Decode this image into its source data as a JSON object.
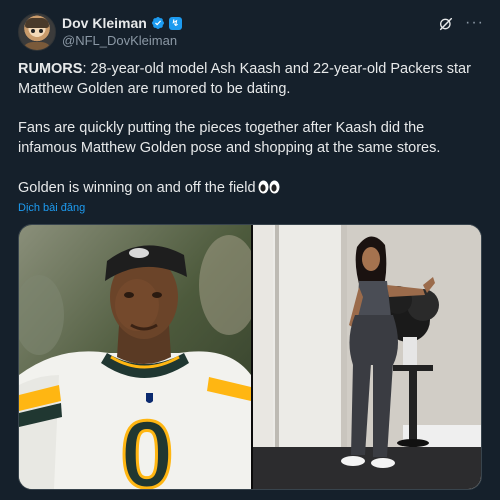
{
  "author": {
    "name": "Dov Kleiman",
    "handle": "@NFL_DovKleiman",
    "affiliate_badge": "↯"
  },
  "tweet": {
    "p1_bold": "RUMORS",
    "p1_rest": ": 28-year-old model Ash Kaash and 22-year-old Packers star Matthew Golden are rumored to be dating.",
    "p2": "Fans are quickly putting the pieces together after Kaash did the infamous Matthew Golden pose and shopping at the same stores.",
    "p3": "Golden is winning on and off the field",
    "translate_label": "Dịch bài đăng"
  },
  "media": {
    "left_jersey_number": "0",
    "left_alt": "football-player-photo",
    "right_alt": "woman-posing-photo"
  },
  "colors": {
    "background": "#15202b",
    "accent": "#1d9bf0",
    "text": "#e7e9ea",
    "muted": "#8b98a5"
  },
  "icons": [
    "verified-badge-icon",
    "affiliate-badge-icon",
    "grok-icon",
    "more-options-icon",
    "eyes-emoji-icon"
  ]
}
